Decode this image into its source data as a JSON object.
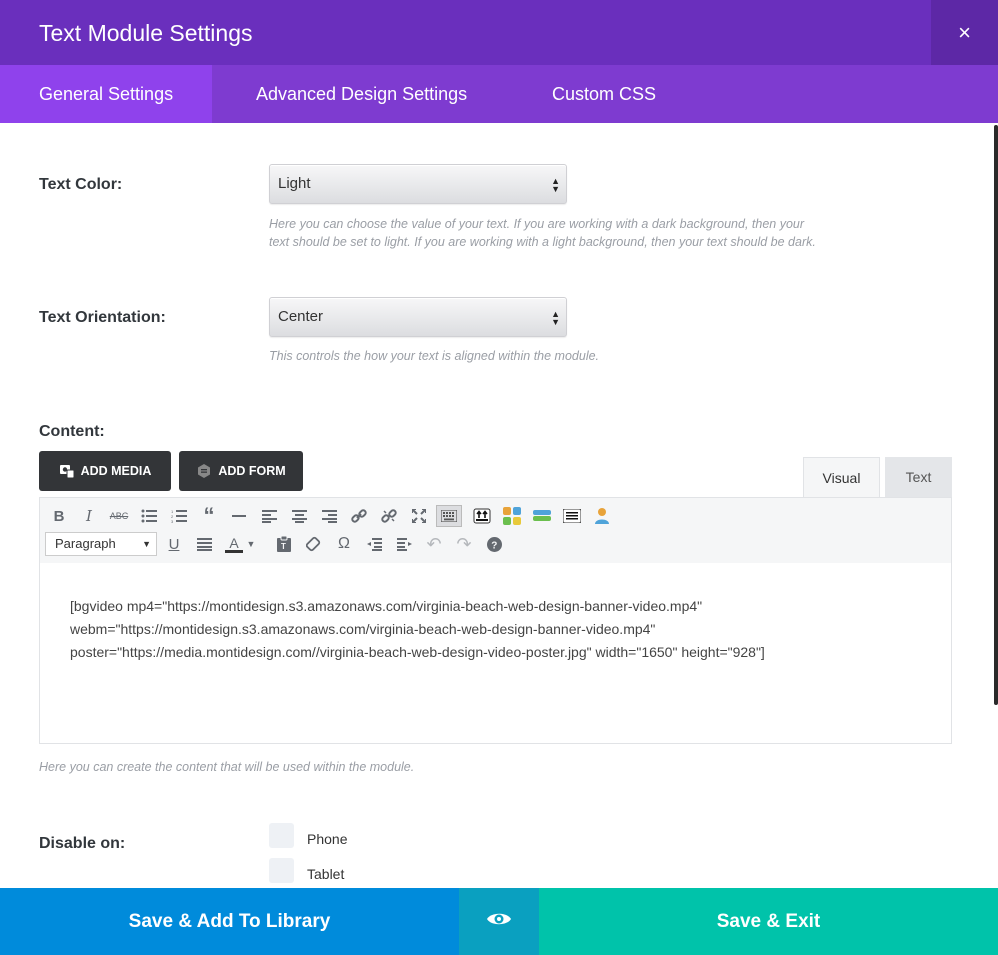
{
  "modal": {
    "title": "Text Module Settings",
    "close_icon": "×"
  },
  "tabs": [
    {
      "label": "General Settings",
      "active": true
    },
    {
      "label": "Advanced Design Settings",
      "active": false
    },
    {
      "label": "Custom CSS",
      "active": false
    }
  ],
  "fields": {
    "text_color": {
      "label": "Text Color:",
      "value": "Light",
      "description_line1": "Here you can choose the value of your text. If you are working with a dark background, then your",
      "description_line2": "text should be set to light. If you are working with a light background, then your text should be dark."
    },
    "text_orientation": {
      "label": "Text Orientation:",
      "value": "Center",
      "description": "This controls the how your text is aligned within the module."
    },
    "content": {
      "label": "Content:",
      "add_media": "ADD MEDIA",
      "add_form": "ADD FORM",
      "tab_visual": "Visual",
      "tab_text": "Text",
      "format_select": "Paragraph",
      "body_line1": "[bgvideo mp4=\"https://montidesign.s3.amazonaws.com/virginia-beach-web-design-banner-video.mp4\"",
      "body_line2": "webm=\"https://montidesign.s3.amazonaws.com/virginia-beach-web-design-banner-video.mp4\"",
      "body_line3": "poster=\"https://media.montidesign.com//virginia-beach-web-design-video-poster.jpg\" width=\"1650\" height=\"928\"]",
      "description": "Here you can create the content that will be used within the module."
    },
    "disable_on": {
      "label": "Disable on:",
      "options": [
        "Phone",
        "Tablet"
      ]
    }
  },
  "footer": {
    "save_library": "Save & Add To Library",
    "preview_icon": "eye-icon",
    "save_exit": "Save & Exit"
  },
  "colors": {
    "header": "#6a2fbd",
    "tabs_bar": "#7e3bd0",
    "active_tab": "#8f42ec",
    "save_library": "#008bdb",
    "preview": "#0aa0c0",
    "save_exit": "#00c3aa"
  }
}
